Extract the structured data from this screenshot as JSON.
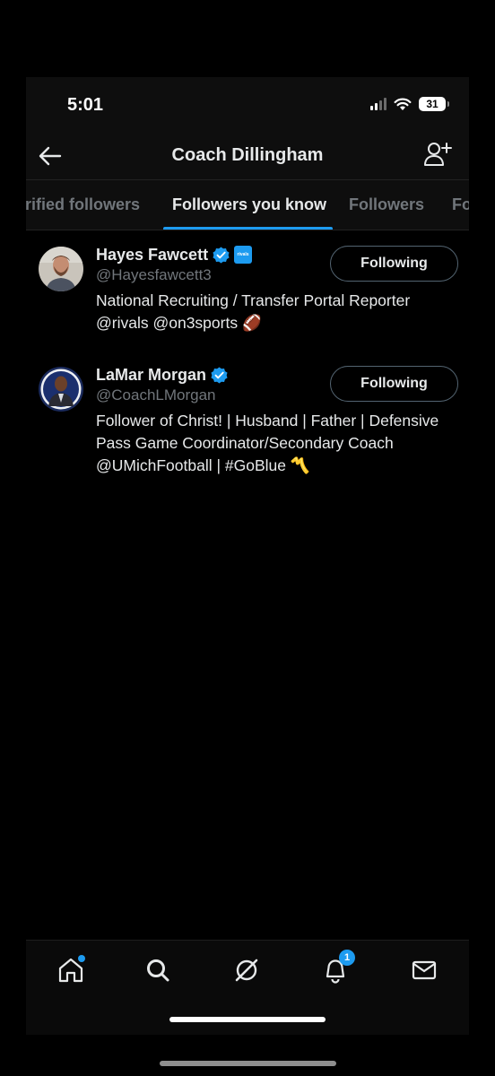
{
  "status_bar": {
    "time": "5:01",
    "battery": "31"
  },
  "header": {
    "title": "Coach Dillingham"
  },
  "tabs": [
    {
      "label": "rified followers"
    },
    {
      "label": "Followers you know"
    },
    {
      "label": "Followers"
    },
    {
      "label": "Fo"
    }
  ],
  "users": [
    {
      "name": "Hayes Fawcett",
      "handle": "@Hayesfawcett3",
      "bio": "National Recruiting / Transfer Portal Reporter @rivals @on3sports 🏈",
      "org_badge": "rivals",
      "button_label": "Following"
    },
    {
      "name": "LaMar Morgan",
      "handle": "@CoachLMorgan",
      "bio": "Follower of Christ! | Husband | Father | Defensive Pass Game Coordinator/Secondary Coach @UMichFootball | #GoBlue 〽️",
      "button_label": "Following"
    }
  ],
  "bottom_nav": {
    "items": [
      "home-icon",
      "search-icon",
      "grok-icon",
      "bell-icon",
      "mail-icon"
    ],
    "notifications_count": "1"
  },
  "colors": {
    "accent": "#1d9bf0",
    "muted": "#71767b",
    "text": "#e7e9ea",
    "background": "#000000"
  }
}
